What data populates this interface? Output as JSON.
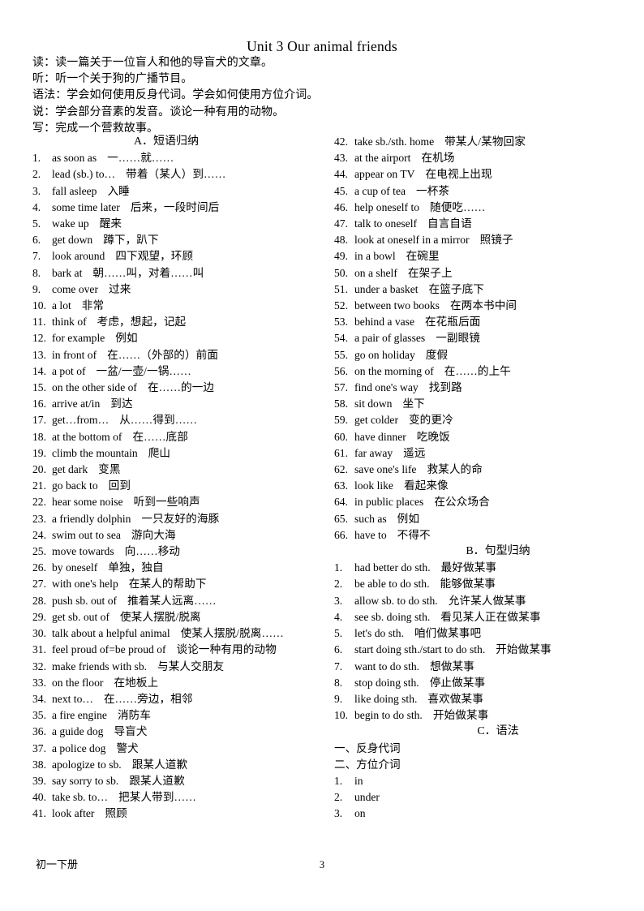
{
  "document": {
    "title": "Unit 3 Our animal friends",
    "footer_label": "初一下册",
    "page_number": "3"
  },
  "objectives": [
    "读：读一篇关于一位盲人和他的导盲犬的文章。",
    "听：听一个关于狗的广播节目。",
    "语法：学会如何使用反身代词。学会如何使用方位介词。",
    "说：学会部分音素的发音。谈论一种有用的动物。",
    "写：完成一个营救故事。"
  ],
  "sections": {
    "a_heading": "A．短语归纳",
    "b_heading": "B．句型归纳",
    "c_heading": "C．语法"
  },
  "phrases_left": [
    {
      "num": "1.",
      "en": "as soon as",
      "cn": "一……就……"
    },
    {
      "num": "2.",
      "en": "lead (sb.) to…",
      "cn": "带着（某人）到……"
    },
    {
      "num": "3.",
      "en": "fall asleep",
      "cn": "入睡"
    },
    {
      "num": "4.",
      "en": "some time later",
      "cn": "后来，一段时间后"
    },
    {
      "num": "5.",
      "en": "wake up",
      "cn": "醒来"
    },
    {
      "num": "6.",
      "en": "get down",
      "cn": "蹲下，趴下"
    },
    {
      "num": "7.",
      "en": "look around",
      "cn": "四下观望，环顾"
    },
    {
      "num": "8.",
      "en": "bark at",
      "cn": "朝……叫，对着……叫"
    },
    {
      "num": "9.",
      "en": "come over",
      "cn": "过来"
    },
    {
      "num": "10.",
      "en": "a lot",
      "cn": "非常"
    },
    {
      "num": "11.",
      "en": "think of",
      "cn": "考虑，想起，记起"
    },
    {
      "num": "12.",
      "en": "for example",
      "cn": "例如"
    },
    {
      "num": "13.",
      "en": "in front of",
      "cn": "在……（外部的）前面"
    },
    {
      "num": "14.",
      "en": "a pot of",
      "cn": "一盆/一壶/一锅……"
    },
    {
      "num": "15.",
      "en": "on the other side of",
      "cn": "在……的一边"
    },
    {
      "num": "16.",
      "en": "arrive at/in",
      "cn": "到达"
    },
    {
      "num": "17.",
      "en": "get…from…",
      "cn": "从……得到……"
    },
    {
      "num": "18.",
      "en": "at the bottom of",
      "cn": "在……底部"
    },
    {
      "num": "19.",
      "en": "climb the mountain",
      "cn": "爬山"
    },
    {
      "num": "20.",
      "en": "get dark",
      "cn": "变黑"
    },
    {
      "num": "21.",
      "en": "go back to",
      "cn": "回到"
    },
    {
      "num": "22.",
      "en": "hear some noise",
      "cn": "听到一些响声"
    },
    {
      "num": "23.",
      "en": "a friendly dolphin",
      "cn": "一只友好的海豚"
    },
    {
      "num": "24.",
      "en": "swim out to sea",
      "cn": "游向大海"
    },
    {
      "num": "25.",
      "en": "move towards",
      "cn": "向……移动"
    },
    {
      "num": "26.",
      "en": "by oneself",
      "cn": "单独，独自"
    },
    {
      "num": "27.",
      "en": "with one's help",
      "cn": "在某人的帮助下"
    },
    {
      "num": "28.",
      "en": "push sb. out of",
      "cn": "推着某人远离……"
    },
    {
      "num": "29.",
      "en": "get sb. out of",
      "cn": "使某人摆脱/脱离"
    },
    {
      "num": "30.",
      "en": "talk about a helpful animal",
      "cn": "使某人摆脱/脱离……"
    },
    {
      "num": "31.",
      "en": "feel proud of=be proud of",
      "cn": "谈论一种有用的动物"
    },
    {
      "num": "32.",
      "en": "make friends with sb.",
      "cn": "与某人交朋友"
    },
    {
      "num": "33.",
      "en": "on the floor",
      "cn": "在地板上"
    },
    {
      "num": "34.",
      "en": "next to…",
      "cn": "在……旁边，相邻"
    },
    {
      "num": "35.",
      "en": "a fire engine",
      "cn": "消防车"
    },
    {
      "num": "36.",
      "en": "a guide dog",
      "cn": "导盲犬"
    },
    {
      "num": "37.",
      "en": "a police dog",
      "cn": "警犬"
    },
    {
      "num": "38.",
      "en": "apologize to sb.",
      "cn": "跟某人道歉"
    },
    {
      "num": "39.",
      "en": "say sorry to sb.",
      "cn": "跟某人道歉"
    },
    {
      "num": "40.",
      "en": "take sb. to…",
      "cn": "把某人带到……"
    },
    {
      "num": "41.",
      "en": "look after",
      "cn": "照顾"
    }
  ],
  "phrases_right": [
    {
      "num": "42.",
      "en": "take sb./sth. home",
      "cn": "带某人/某物回家"
    },
    {
      "num": "43.",
      "en": "at the airport",
      "cn": "在机场"
    },
    {
      "num": "44.",
      "en": "appear on TV",
      "cn": "在电视上出现"
    },
    {
      "num": "45.",
      "en": "a cup of tea",
      "cn": "一杯茶"
    },
    {
      "num": "46.",
      "en": "help oneself to",
      "cn": "随便吃……"
    },
    {
      "num": "47.",
      "en": "talk to oneself",
      "cn": "自言自语"
    },
    {
      "num": "48.",
      "en": "look at oneself in a mirror",
      "cn": "照镜子"
    },
    {
      "num": "49.",
      "en": "in a bowl",
      "cn": "在碗里"
    },
    {
      "num": "50.",
      "en": "on a shelf",
      "cn": "在架子上"
    },
    {
      "num": "51.",
      "en": "under a basket",
      "cn": "在篮子底下"
    },
    {
      "num": "52.",
      "en": "between two books",
      "cn": "在两本书中间"
    },
    {
      "num": "53.",
      "en": "behind a vase",
      "cn": "在花瓶后面"
    },
    {
      "num": "54.",
      "en": "a pair of glasses",
      "cn": "一副眼镜"
    },
    {
      "num": "55.",
      "en": "go on holiday",
      "cn": "度假"
    },
    {
      "num": "56.",
      "en": "on the morning of",
      "cn": "在……的上午"
    },
    {
      "num": "57.",
      "en": "find one's way",
      "cn": "找到路"
    },
    {
      "num": "58.",
      "en": "sit down",
      "cn": "坐下"
    },
    {
      "num": "59.",
      "en": "get colder",
      "cn": "变的更冷"
    },
    {
      "num": "60.",
      "en": "have dinner",
      "cn": "吃晚饭"
    },
    {
      "num": "61.",
      "en": "far away",
      "cn": "遥远"
    },
    {
      "num": "62.",
      "en": "save one's life",
      "cn": "救某人的命"
    },
    {
      "num": "63.",
      "en": "look like",
      "cn": "看起来像"
    },
    {
      "num": "64.",
      "en": "in public places",
      "cn": "在公众场合"
    },
    {
      "num": "65.",
      "en": "such as",
      "cn": "例如"
    },
    {
      "num": "66.",
      "en": "have to",
      "cn": "不得不"
    }
  ],
  "sentence_patterns": [
    {
      "num": "1.",
      "en": "had better do sth.",
      "cn": "最好做某事"
    },
    {
      "num": "2.",
      "en": "be able to do sth.",
      "cn": "能够做某事"
    },
    {
      "num": "3.",
      "en": "allow sb. to do sth.",
      "cn": "允许某人做某事"
    },
    {
      "num": "4.",
      "en": "see sb. doing sth.",
      "cn": "看见某人正在做某事"
    },
    {
      "num": "5.",
      "en": "let's do sth.",
      "cn": "咱们做某事吧"
    },
    {
      "num": "6.",
      "en": "start doing sth./start to do sth.",
      "cn": "开始做某事"
    },
    {
      "num": "7.",
      "en": "want to do sth.",
      "cn": "想做某事"
    },
    {
      "num": "8.",
      "en": "stop doing sth.",
      "cn": "停止做某事"
    },
    {
      "num": "9.",
      "en": "like doing sth.",
      "cn": "喜欢做某事"
    },
    {
      "num": "10.",
      "en": "begin to do sth.",
      "cn": "开始做某事"
    }
  ],
  "grammar": {
    "topic_1": "一、反身代词",
    "topic_2": "二、方位介词",
    "prepositions": [
      {
        "num": "1.",
        "en": "in"
      },
      {
        "num": "2.",
        "en": "under"
      },
      {
        "num": "3.",
        "en": "on"
      }
    ]
  }
}
